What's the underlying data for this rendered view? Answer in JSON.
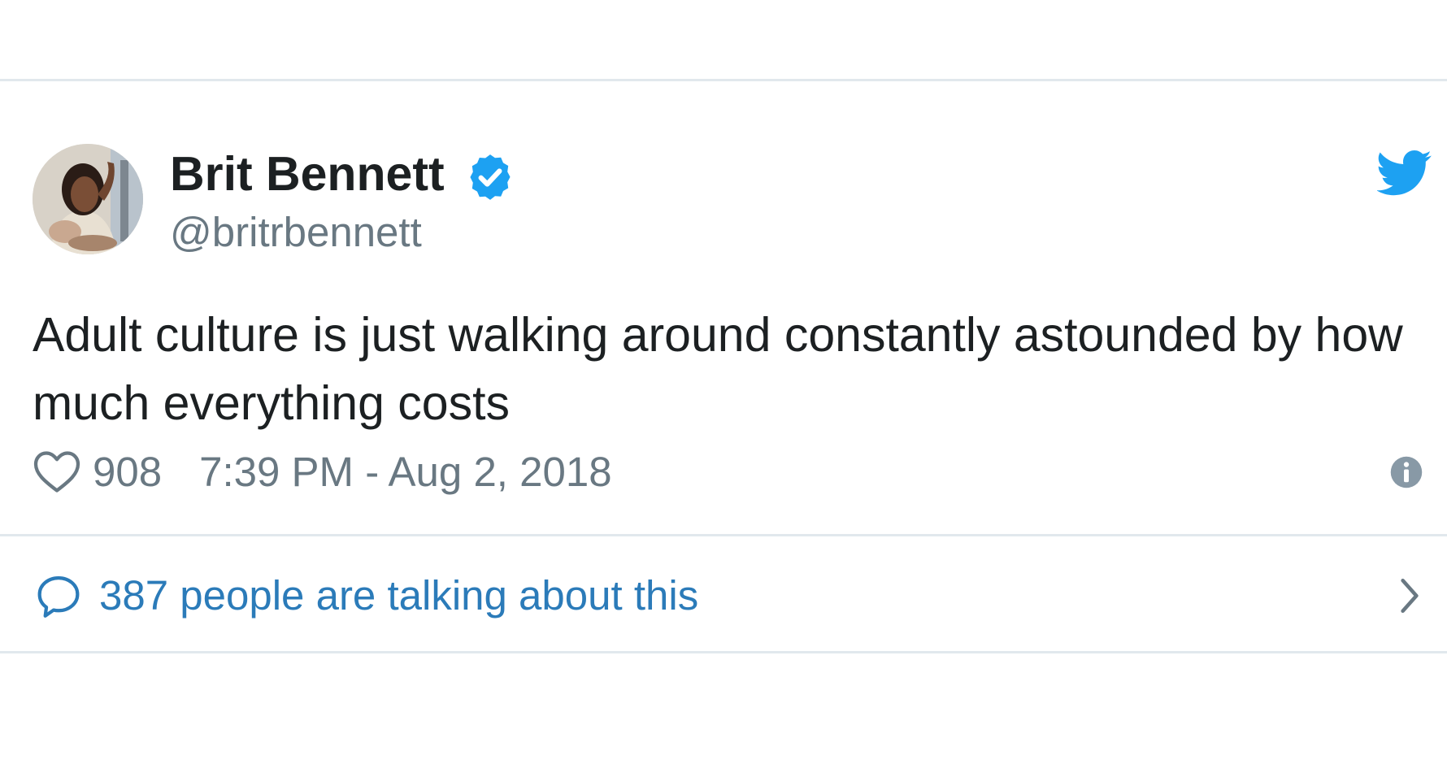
{
  "tweet": {
    "author_name": "Brit Bennett",
    "handle": "@britrbennett",
    "text": "Adult culture is just walking around constantly astounded by how much everything costs",
    "likes": "908",
    "timestamp": "7:39 PM - Aug 2, 2018",
    "conversation_label": "387 people are talking about this"
  },
  "icons": {
    "verified": "verified-badge-icon",
    "logo": "twitter-bird-icon",
    "like": "heart-icon",
    "info": "info-icon",
    "reply": "speech-bubble-icon",
    "chevron": "chevron-right-icon"
  },
  "colors": {
    "brand_blue": "#1da1f2",
    "link_blue": "#2b7bb9",
    "text": "#1c2022",
    "muted": "#697882",
    "divider": "#e1e8ed"
  }
}
